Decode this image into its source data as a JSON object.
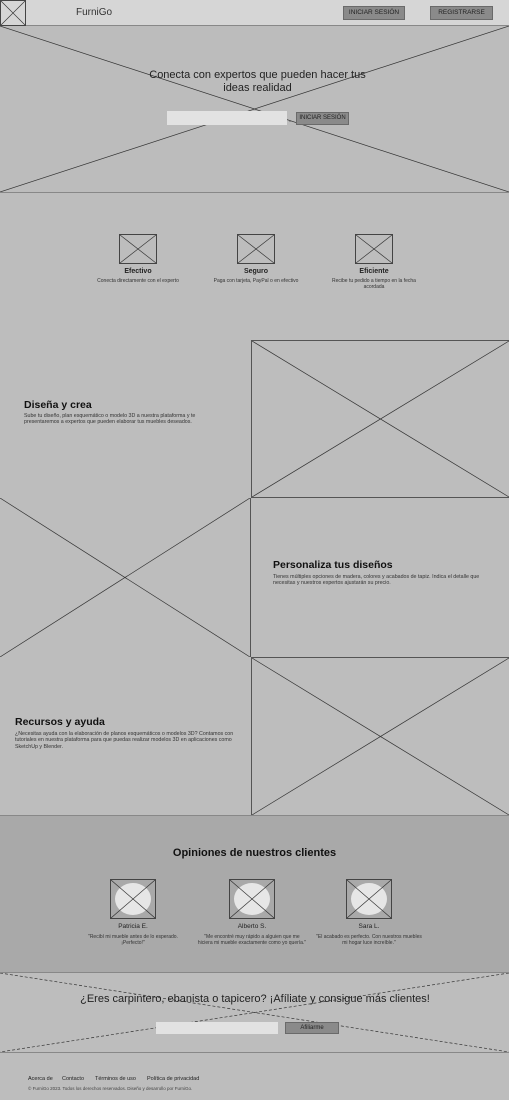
{
  "header": {
    "brand": "FurniGo",
    "login_label": "INICIAR SESIÓN",
    "register_label": "REGISTRARSE"
  },
  "hero": {
    "title": "Conecta con expertos que pueden hacer tus ideas realidad",
    "input_placeholder": "",
    "button_label": "INICIAR SESIÓN"
  },
  "features": [
    {
      "title": "Efectivo",
      "description": "Conecta directamente con el experto"
    },
    {
      "title": "Seguro",
      "description": "Paga con tarjeta, PayPal o en efectivo"
    },
    {
      "title": "Eficiente",
      "description": "Recibe tu pedido a tiempo en la fecha acordada"
    }
  ],
  "sections": [
    {
      "title": "Diseña y crea",
      "text": "Sube tu diseño, plan esquemático o modelo 3D a nuestra plataforma y te presentaremos a expertos que pueden elaborar tus muebles deseados."
    },
    {
      "title": "Personaliza tus diseños",
      "text": "Tienes múltiples opciones de madera, colores y acabados de tapiz. Indica el detalle que necesitas y nuestros expertos ajustarán su precio."
    },
    {
      "title": "Recursos y ayuda",
      "text": "¿Necesitas ayuda con la elaboración de planos esquemáticos o modelos 3D? Contamos con tutoriales en nuestra plataforma para que puedas realizar modelos 3D en aplicaciones como SketchUp y Blender."
    }
  ],
  "testimonials": {
    "title": "Opiniones de nuestros clientes",
    "items": [
      {
        "name": "Patricia E.",
        "quote": "\"Recibí mi mueble antes de lo esperado. ¡Perfecto!\""
      },
      {
        "name": "Alberto S.",
        "quote": "\"Me encontré muy rápido a alguien que me hiciera mi mueble exactamente como yo quería.\""
      },
      {
        "name": "Sara L.",
        "quote": "\"El acabado es perfecto. Con nuestros muebles mi hogar luce increíble.\""
      }
    ]
  },
  "cta": {
    "title": "¿Eres carpintero, ebanista o tapicero? ¡Afíliate y consigue más clientes!",
    "input_placeholder": "",
    "button_label": "Afiliarme"
  },
  "footer": {
    "links": [
      "Acerca de",
      "Contacto",
      "Términos de uso",
      "Política de privacidad"
    ],
    "copyright": "© FurniGo 2023. Todos los derechos reservados. Diseño y desarrollo por FurniGo."
  }
}
